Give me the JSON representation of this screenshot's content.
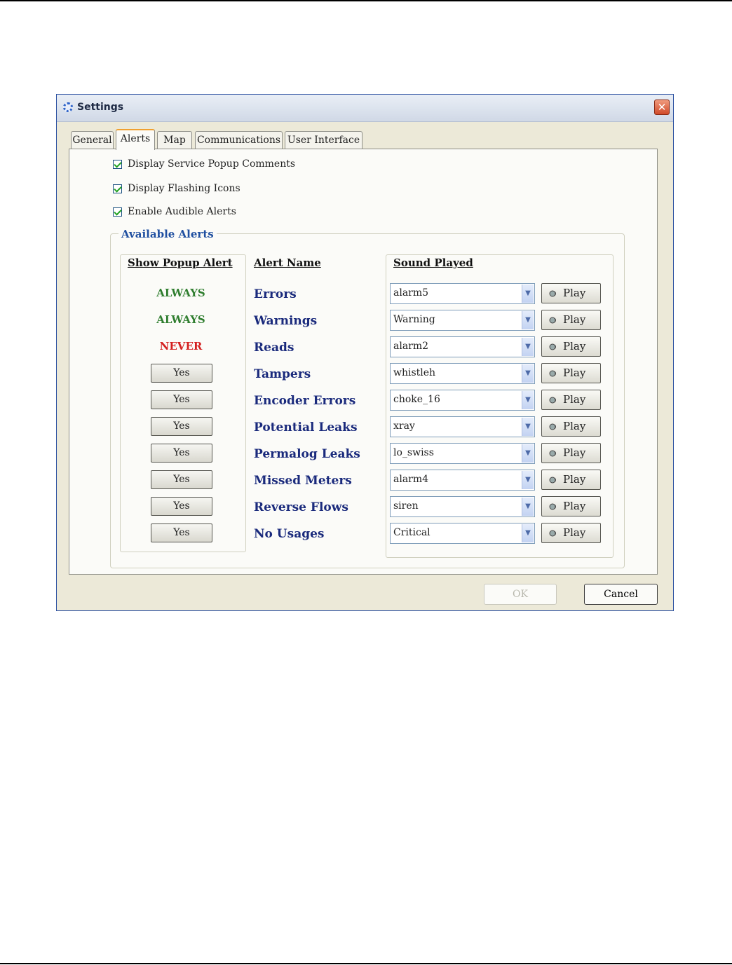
{
  "window": {
    "title": "Settings"
  },
  "tabs": [
    "General",
    "Alerts",
    "Map",
    "Communications",
    "User Interface"
  ],
  "active_tab": "Alerts",
  "options": [
    {
      "label": "Display Service Popup Comments",
      "checked": true
    },
    {
      "label": "Display Flashing Icons",
      "checked": true
    },
    {
      "label": "Enable Audible Alerts",
      "checked": true
    }
  ],
  "group": {
    "title": "Available Alerts"
  },
  "columns": {
    "popup": "Show Popup Alert",
    "name": "Alert Name",
    "sound": "Sound Played"
  },
  "alerts": [
    {
      "popup": "ALWAYS",
      "name": "Errors",
      "sound": "alarm5"
    },
    {
      "popup": "ALWAYS",
      "name": "Warnings",
      "sound": "Warning"
    },
    {
      "popup": "NEVER",
      "name": "Reads",
      "sound": "alarm2"
    },
    {
      "popup": "Yes",
      "name": "Tampers",
      "sound": "whistleh"
    },
    {
      "popup": "Yes",
      "name": "Encoder Errors",
      "sound": "choke_16"
    },
    {
      "popup": "Yes",
      "name": "Potential Leaks",
      "sound": "xray"
    },
    {
      "popup": "Yes",
      "name": "Permalog Leaks",
      "sound": "lo_swiss"
    },
    {
      "popup": "Yes",
      "name": "Missed Meters",
      "sound": "alarm4"
    },
    {
      "popup": "Yes",
      "name": "Reverse Flows",
      "sound": "siren"
    },
    {
      "popup": "Yes",
      "name": "No Usages",
      "sound": "Critical"
    }
  ],
  "play_label": "Play",
  "buttons": {
    "ok": "OK",
    "cancel": "Cancel"
  },
  "colors": {
    "always": "#2e7d2e",
    "never": "#d42020",
    "alert_name": "#1a2a7c",
    "group_title": "#1f4fa0",
    "tab_highlight": "#f0a030"
  },
  "icons": {
    "title": "settings-gear-icon",
    "close": "close-icon",
    "play": "speaker-icon",
    "dropdown": "chevron-down-icon"
  }
}
